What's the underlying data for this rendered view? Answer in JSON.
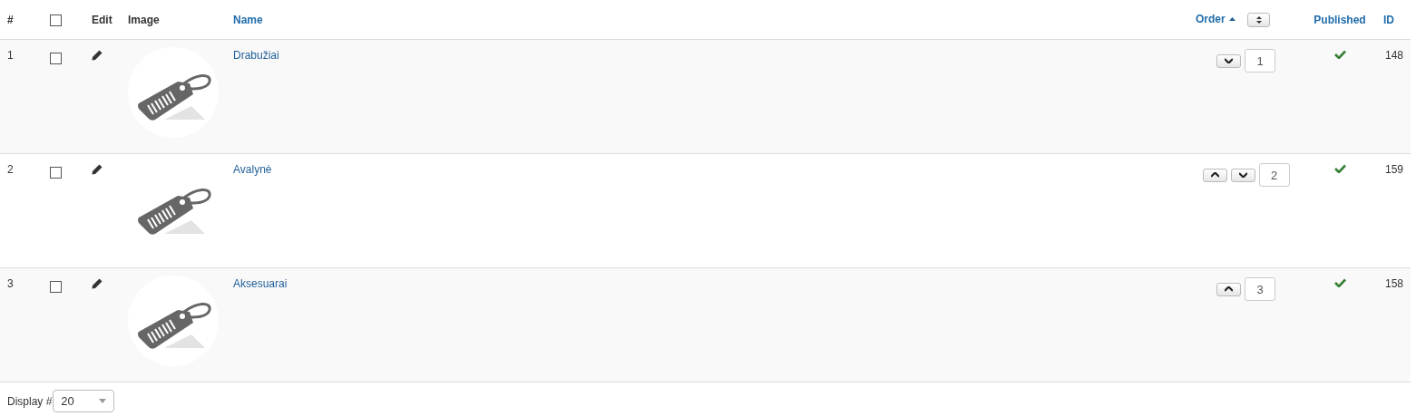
{
  "table": {
    "columns": {
      "number": "#",
      "edit": "Edit",
      "image": "Image",
      "name": "Name",
      "order": "Order",
      "published": "Published",
      "id": "ID"
    },
    "select_all": {
      "checked": false
    },
    "rows": [
      {
        "number": "1",
        "checked": false,
        "name": "Drabužiai",
        "can_move_up": false,
        "can_move_down": true,
        "order": "1",
        "published": true,
        "id": "148"
      },
      {
        "number": "2",
        "checked": false,
        "name": "Avalynė",
        "can_move_up": true,
        "can_move_down": true,
        "order": "2",
        "published": true,
        "id": "159"
      },
      {
        "number": "3",
        "checked": false,
        "name": "Aksesuarai",
        "can_move_up": true,
        "can_move_down": false,
        "order": "3",
        "published": true,
        "id": "158"
      }
    ]
  },
  "footer": {
    "label": "Display #",
    "page_size": "20"
  }
}
